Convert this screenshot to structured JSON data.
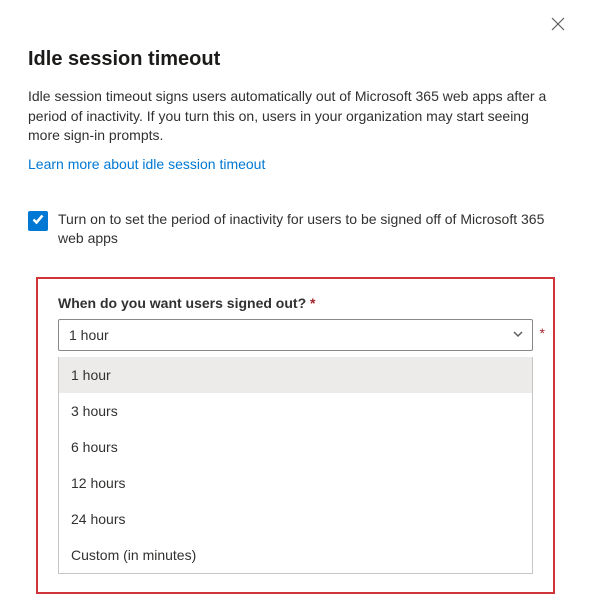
{
  "title": "Idle session timeout",
  "description": "Idle session timeout signs users automatically out of Microsoft 365 web apps after a period of inactivity. If you turn this on, users in your organization may start seeing more sign-in prompts.",
  "learnMoreLink": "Learn more about idle session timeout",
  "checkbox": {
    "checked": true,
    "label": "Turn on to set the period of inactivity for users to be signed off of Microsoft 365 web apps"
  },
  "field": {
    "label": "When do you want users signed out?",
    "requiredMark": "*",
    "selectedValue": "1 hour",
    "options": [
      "1 hour",
      "3 hours",
      "6 hours",
      "12 hours",
      "24 hours",
      "Custom (in minutes)"
    ]
  }
}
